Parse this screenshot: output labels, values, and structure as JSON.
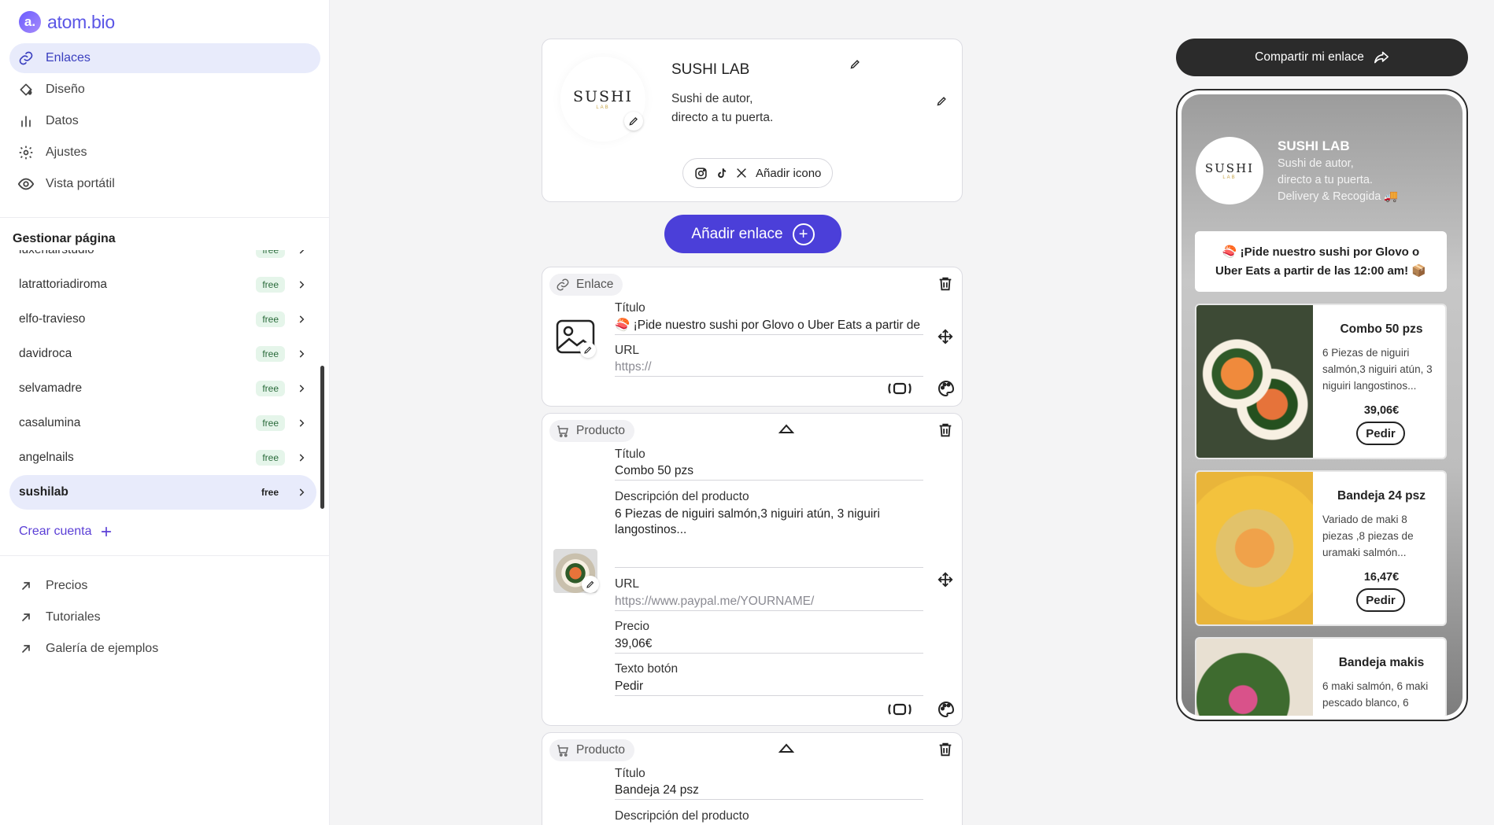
{
  "brand": {
    "logo_letter": "a.",
    "name": "atom.bio"
  },
  "nav": [
    {
      "label": "Enlaces",
      "icon": "link-icon",
      "active": true
    },
    {
      "label": "Diseño",
      "icon": "paint-bucket-icon",
      "active": false
    },
    {
      "label": "Datos",
      "icon": "bar-chart-icon",
      "active": false
    },
    {
      "label": "Ajustes",
      "icon": "gear-icon",
      "active": false
    },
    {
      "label": "Vista portátil",
      "icon": "eye-icon",
      "active": false
    }
  ],
  "manage": {
    "title": "Gestionar página",
    "pages": [
      {
        "name": "luxehairstudio",
        "badge": "free"
      },
      {
        "name": "latrattoriadiroma",
        "badge": "free"
      },
      {
        "name": "elfo-travieso",
        "badge": "free"
      },
      {
        "name": "davidroca",
        "badge": "free"
      },
      {
        "name": "selvamadre",
        "badge": "free"
      },
      {
        "name": "casalumina",
        "badge": "free"
      },
      {
        "name": "angelnails",
        "badge": "free"
      },
      {
        "name": "sushilab",
        "badge": "free",
        "active": true
      }
    ],
    "create_label": "Crear cuenta"
  },
  "bottom_nav": [
    {
      "label": "Precios",
      "icon": "external-arrow-icon"
    },
    {
      "label": "Tutoriales",
      "icon": "external-arrow-icon"
    },
    {
      "label": "Galería de ejemplos",
      "icon": "external-arrow-icon"
    }
  ],
  "profile": {
    "logo_word": "SUSHI",
    "logo_sub": "LAB",
    "name": "SUSHI LAB",
    "bio_line1": "Sushi de autor,",
    "bio_line2": "directo a tu puerta.",
    "add_icon_label": "Añadir icono"
  },
  "add_link_label": "Añadir enlace",
  "link_card": {
    "type_label": "Enlace",
    "title_label": "Título",
    "title_value": "🍣 ¡Pide nuestro sushi por Glovo o Uber Eats a partir de las 12:00 am! 📦",
    "url_label": "URL",
    "url_placeholder": "https://"
  },
  "product1": {
    "type_label": "Producto",
    "title_label": "Título",
    "title_value": "Combo 50 pzs",
    "desc_label": "Descripción del producto",
    "desc_value_line1": "6 Piezas de niguiri salmón,3 niguiri atún, 3 niguiri",
    "desc_value_line2": "langostinos...",
    "url_label": "URL",
    "url_placeholder": "https://www.paypal.me/YOURNAME/",
    "price_label": "Precio",
    "price_value": "39,06€",
    "button_label": "Texto botón",
    "button_value": "Pedir"
  },
  "product2": {
    "type_label": "Producto",
    "title_label": "Título",
    "title_value": "Bandeja 24 psz",
    "desc_label": "Descripción del producto"
  },
  "preview": {
    "share_label": "Compartir mi enlace",
    "name": "SUSHI LAB",
    "bio_line1": "Sushi de autor,",
    "bio_line2": "directo a tu puerta.",
    "bio_line3": "Delivery & Recogida 🚚",
    "banner": "🍣 ¡Pide nuestro sushi por Glovo o Uber Eats a partir de las 12:00 am! 📦",
    "products": [
      {
        "title": "Combo 50 pzs",
        "desc": "6 Piezas de niguiri salmón,3 niguiri atún, 3 niguiri langostinos...",
        "price": "39,06€",
        "button": "Pedir"
      },
      {
        "title": "Bandeja 24 psz",
        "desc": "Variado de maki 8 piezas ,8 piezas de uramaki salmón...",
        "price": "16,47€",
        "button": "Pedir"
      },
      {
        "title": "Bandeja makis",
        "desc": "6 maki salmón, 6 maki pescado blanco, 6"
      }
    ]
  },
  "colors": {
    "accent": "#4b3fd9",
    "active_bg": "#e8ebfb",
    "badge_bg": "#e5f5ea",
    "share_bg": "#2b2b2b"
  }
}
